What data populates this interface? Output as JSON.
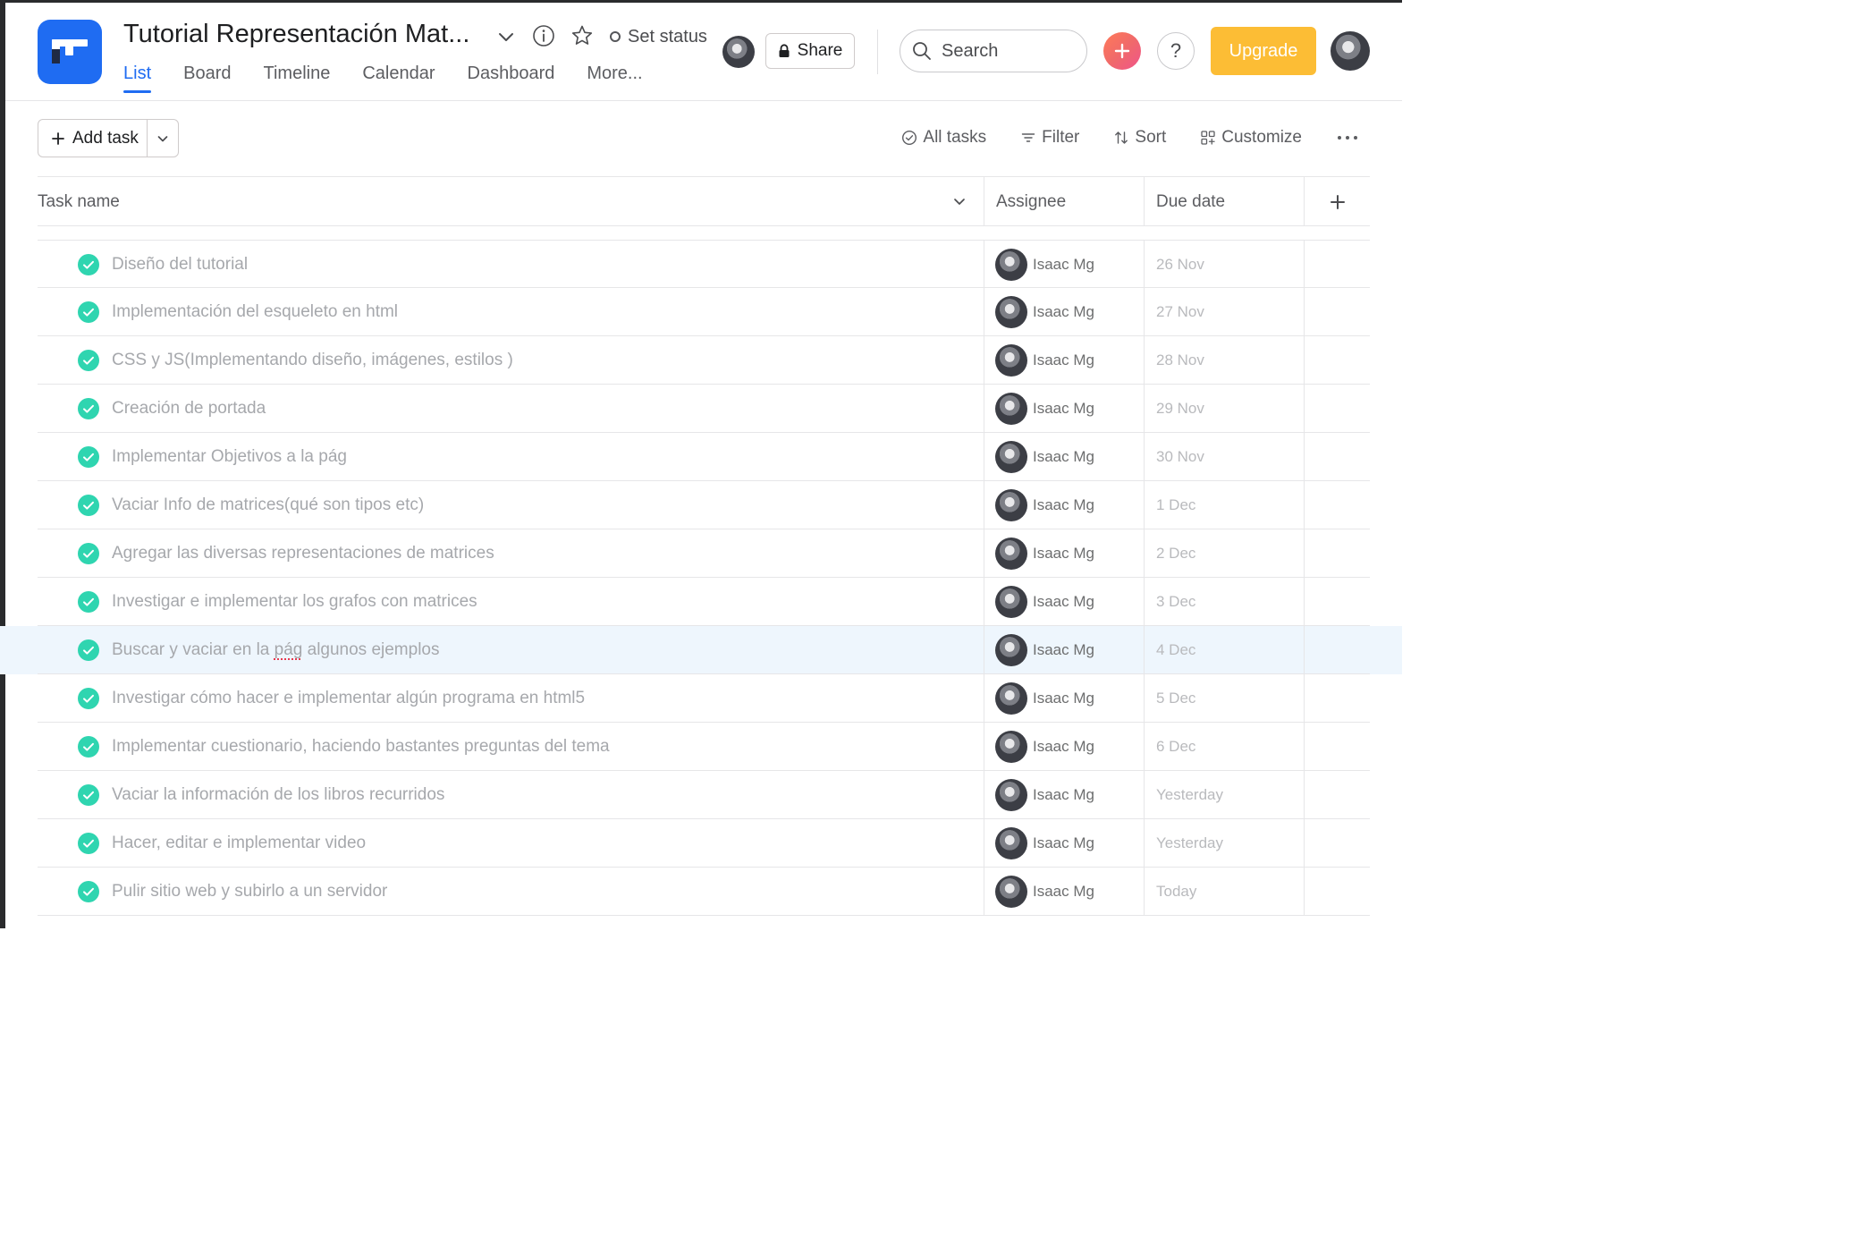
{
  "project": {
    "title": "Tutorial Representación Mat...",
    "set_status_label": "Set status"
  },
  "tabs": [
    {
      "label": "List",
      "active": true
    },
    {
      "label": "Board"
    },
    {
      "label": "Timeline"
    },
    {
      "label": "Calendar"
    },
    {
      "label": "Dashboard"
    },
    {
      "label": "More..."
    }
  ],
  "header_actions": {
    "share_label": "Share",
    "search_placeholder": "Search",
    "help_label": "?",
    "upgrade_label": "Upgrade"
  },
  "toolbar": {
    "add_task_label": "Add task",
    "all_tasks_label": "All tasks",
    "filter_label": "Filter",
    "sort_label": "Sort",
    "customize_label": "Customize"
  },
  "columns": {
    "task_name": "Task name",
    "assignee": "Assignee",
    "due_date": "Due date"
  },
  "tasks": [
    {
      "title": "Diseño del tutorial",
      "assignee": "Isaac Mg",
      "due": "26 Nov",
      "completed": true
    },
    {
      "title": "Implementación del esqueleto en html",
      "assignee": "Isaac Mg",
      "due": "27 Nov",
      "completed": true
    },
    {
      "title": "CSS y JS(Implementando diseño, imágenes, estilos )",
      "assignee": "Isaac Mg",
      "due": "28 Nov",
      "completed": true
    },
    {
      "title": "Creación de portada",
      "assignee": "Isaac Mg",
      "due": "29 Nov",
      "completed": true
    },
    {
      "title": "Implementar Objetivos a la pág",
      "assignee": "Isaac Mg",
      "due": "30 Nov",
      "completed": true
    },
    {
      "title": "Vaciar Info de matrices(qué son tipos etc)",
      "assignee": "Isaac Mg",
      "due": "1 Dec",
      "completed": true
    },
    {
      "title": "Agregar las diversas representaciones de matrices",
      "assignee": "Isaac Mg",
      "due": "2 Dec",
      "completed": true
    },
    {
      "title": "Investigar e implementar los grafos con matrices",
      "assignee": "Isaac Mg",
      "due": "3 Dec",
      "completed": true
    },
    {
      "title_before": "Buscar y vaciar en la ",
      "title_flagged": "pág",
      "title_after": " algunos ejemplos",
      "assignee": "Isaac Mg",
      "due": "4 Dec",
      "completed": true,
      "hovered": true
    },
    {
      "title": "Investigar cómo hacer e implementar algún programa en html5",
      "assignee": "Isaac Mg",
      "due": "5 Dec",
      "completed": true
    },
    {
      "title": "Implementar cuestionario, haciendo bastantes preguntas del tema",
      "assignee": "Isaac Mg",
      "due": "6 Dec",
      "completed": true
    },
    {
      "title": "Vaciar la información de los libros recurridos",
      "assignee": "Isaac Mg",
      "due": "Yesterday",
      "completed": true
    },
    {
      "title": "Hacer, editar e implementar video",
      "assignee": "Isaac Mg",
      "due": "Yesterday",
      "completed": true
    },
    {
      "title": "Pulir sitio web y subirlo a un servidor",
      "assignee": "Isaac Mg",
      "due": "Today",
      "completed": true
    }
  ],
  "colors": {
    "brand_blue": "#1f6cf2",
    "upgrade_yellow": "#fcbd35",
    "complete_green": "#2fd5b0",
    "row_highlight": "#eef6fd"
  }
}
